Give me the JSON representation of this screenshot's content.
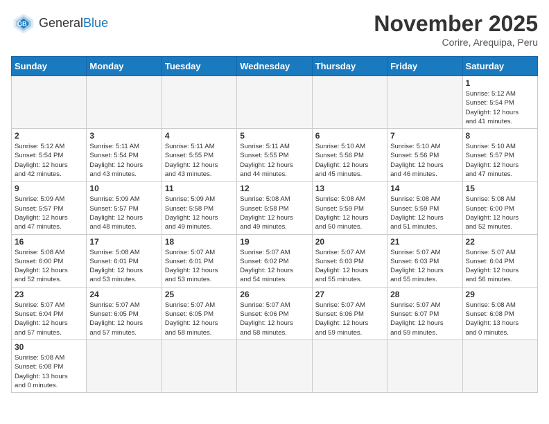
{
  "header": {
    "logo_general": "General",
    "logo_blue": "Blue",
    "month_title": "November 2025",
    "location": "Corire, Arequipa, Peru"
  },
  "weekdays": [
    "Sunday",
    "Monday",
    "Tuesday",
    "Wednesday",
    "Thursday",
    "Friday",
    "Saturday"
  ],
  "weeks": [
    [
      {
        "day": "",
        "info": ""
      },
      {
        "day": "",
        "info": ""
      },
      {
        "day": "",
        "info": ""
      },
      {
        "day": "",
        "info": ""
      },
      {
        "day": "",
        "info": ""
      },
      {
        "day": "",
        "info": ""
      },
      {
        "day": "1",
        "info": "Sunrise: 5:12 AM\nSunset: 5:54 PM\nDaylight: 12 hours\nand 41 minutes."
      }
    ],
    [
      {
        "day": "2",
        "info": "Sunrise: 5:12 AM\nSunset: 5:54 PM\nDaylight: 12 hours\nand 42 minutes."
      },
      {
        "day": "3",
        "info": "Sunrise: 5:11 AM\nSunset: 5:54 PM\nDaylight: 12 hours\nand 43 minutes."
      },
      {
        "day": "4",
        "info": "Sunrise: 5:11 AM\nSunset: 5:55 PM\nDaylight: 12 hours\nand 43 minutes."
      },
      {
        "day": "5",
        "info": "Sunrise: 5:11 AM\nSunset: 5:55 PM\nDaylight: 12 hours\nand 44 minutes."
      },
      {
        "day": "6",
        "info": "Sunrise: 5:10 AM\nSunset: 5:56 PM\nDaylight: 12 hours\nand 45 minutes."
      },
      {
        "day": "7",
        "info": "Sunrise: 5:10 AM\nSunset: 5:56 PM\nDaylight: 12 hours\nand 46 minutes."
      },
      {
        "day": "8",
        "info": "Sunrise: 5:10 AM\nSunset: 5:57 PM\nDaylight: 12 hours\nand 47 minutes."
      }
    ],
    [
      {
        "day": "9",
        "info": "Sunrise: 5:09 AM\nSunset: 5:57 PM\nDaylight: 12 hours\nand 47 minutes."
      },
      {
        "day": "10",
        "info": "Sunrise: 5:09 AM\nSunset: 5:57 PM\nDaylight: 12 hours\nand 48 minutes."
      },
      {
        "day": "11",
        "info": "Sunrise: 5:09 AM\nSunset: 5:58 PM\nDaylight: 12 hours\nand 49 minutes."
      },
      {
        "day": "12",
        "info": "Sunrise: 5:08 AM\nSunset: 5:58 PM\nDaylight: 12 hours\nand 49 minutes."
      },
      {
        "day": "13",
        "info": "Sunrise: 5:08 AM\nSunset: 5:59 PM\nDaylight: 12 hours\nand 50 minutes."
      },
      {
        "day": "14",
        "info": "Sunrise: 5:08 AM\nSunset: 5:59 PM\nDaylight: 12 hours\nand 51 minutes."
      },
      {
        "day": "15",
        "info": "Sunrise: 5:08 AM\nSunset: 6:00 PM\nDaylight: 12 hours\nand 52 minutes."
      }
    ],
    [
      {
        "day": "16",
        "info": "Sunrise: 5:08 AM\nSunset: 6:00 PM\nDaylight: 12 hours\nand 52 minutes."
      },
      {
        "day": "17",
        "info": "Sunrise: 5:08 AM\nSunset: 6:01 PM\nDaylight: 12 hours\nand 53 minutes."
      },
      {
        "day": "18",
        "info": "Sunrise: 5:07 AM\nSunset: 6:01 PM\nDaylight: 12 hours\nand 53 minutes."
      },
      {
        "day": "19",
        "info": "Sunrise: 5:07 AM\nSunset: 6:02 PM\nDaylight: 12 hours\nand 54 minutes."
      },
      {
        "day": "20",
        "info": "Sunrise: 5:07 AM\nSunset: 6:03 PM\nDaylight: 12 hours\nand 55 minutes."
      },
      {
        "day": "21",
        "info": "Sunrise: 5:07 AM\nSunset: 6:03 PM\nDaylight: 12 hours\nand 55 minutes."
      },
      {
        "day": "22",
        "info": "Sunrise: 5:07 AM\nSunset: 6:04 PM\nDaylight: 12 hours\nand 56 minutes."
      }
    ],
    [
      {
        "day": "23",
        "info": "Sunrise: 5:07 AM\nSunset: 6:04 PM\nDaylight: 12 hours\nand 57 minutes."
      },
      {
        "day": "24",
        "info": "Sunrise: 5:07 AM\nSunset: 6:05 PM\nDaylight: 12 hours\nand 57 minutes."
      },
      {
        "day": "25",
        "info": "Sunrise: 5:07 AM\nSunset: 6:05 PM\nDaylight: 12 hours\nand 58 minutes."
      },
      {
        "day": "26",
        "info": "Sunrise: 5:07 AM\nSunset: 6:06 PM\nDaylight: 12 hours\nand 58 minutes."
      },
      {
        "day": "27",
        "info": "Sunrise: 5:07 AM\nSunset: 6:06 PM\nDaylight: 12 hours\nand 59 minutes."
      },
      {
        "day": "28",
        "info": "Sunrise: 5:07 AM\nSunset: 6:07 PM\nDaylight: 12 hours\nand 59 minutes."
      },
      {
        "day": "29",
        "info": "Sunrise: 5:08 AM\nSunset: 6:08 PM\nDaylight: 13 hours\nand 0 minutes."
      }
    ],
    [
      {
        "day": "30",
        "info": "Sunrise: 5:08 AM\nSunset: 6:08 PM\nDaylight: 13 hours\nand 0 minutes."
      },
      {
        "day": "",
        "info": ""
      },
      {
        "day": "",
        "info": ""
      },
      {
        "day": "",
        "info": ""
      },
      {
        "day": "",
        "info": ""
      },
      {
        "day": "",
        "info": ""
      },
      {
        "day": "",
        "info": ""
      }
    ]
  ]
}
